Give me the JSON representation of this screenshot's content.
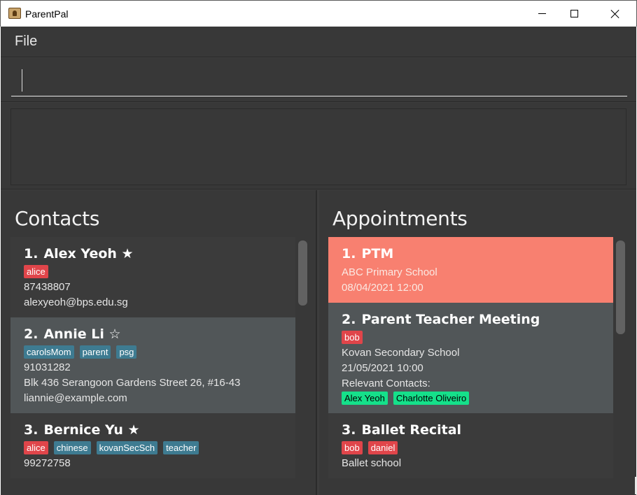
{
  "window": {
    "title": "ParentPal"
  },
  "menu": {
    "file_label": "File"
  },
  "command": {
    "value": ""
  },
  "contacts": {
    "title": "Contacts",
    "items": [
      {
        "index": "1.",
        "name": "Alex Yeoh ★",
        "tags": [
          {
            "label": "alice",
            "color": "red"
          }
        ],
        "lines": [
          "87438807",
          "alexyeoh@bps.edu.sg"
        ]
      },
      {
        "index": "2.",
        "name": "Annie Li ☆",
        "tags": [
          {
            "label": "carolsMom",
            "color": "blue"
          },
          {
            "label": "parent",
            "color": "blue"
          },
          {
            "label": "psg",
            "color": "blue"
          }
        ],
        "lines": [
          "91031282",
          "Blk 436 Serangoon Gardens Street 26, #16-43",
          "liannie@example.com"
        ]
      },
      {
        "index": "3.",
        "name": "Bernice Yu ★",
        "tags": [
          {
            "label": "alice",
            "color": "red"
          },
          {
            "label": "chinese",
            "color": "blue"
          },
          {
            "label": "kovanSecSch",
            "color": "blue"
          },
          {
            "label": "teacher",
            "color": "blue"
          }
        ],
        "lines": [
          "99272758"
        ]
      }
    ]
  },
  "appointments": {
    "title": "Appointments",
    "items": [
      {
        "index": "1.",
        "name": "PTM",
        "lines": [
          "ABC Primary School",
          "08/04/2021 12:00"
        ]
      },
      {
        "index": "2.",
        "name": "Parent Teacher Meeting",
        "tags": [
          {
            "label": "bob",
            "color": "red"
          }
        ],
        "lines": [
          "Kovan Secondary School",
          "21/05/2021 10:00",
          "Relevant Contacts:"
        ],
        "contacts": [
          "Alex Yeoh",
          "Charlotte Oliveiro"
        ]
      },
      {
        "index": "3.",
        "name": "Ballet Recital",
        "tags": [
          {
            "label": "bob",
            "color": "red"
          },
          {
            "label": "daniel",
            "color": "red"
          }
        ],
        "lines": [
          "Ballet school"
        ]
      }
    ]
  },
  "colors": {
    "highlight": "#f88070",
    "tag_red": "#e0454a",
    "tag_blue": "#3e7b91",
    "tag_green": "#15e08a"
  }
}
